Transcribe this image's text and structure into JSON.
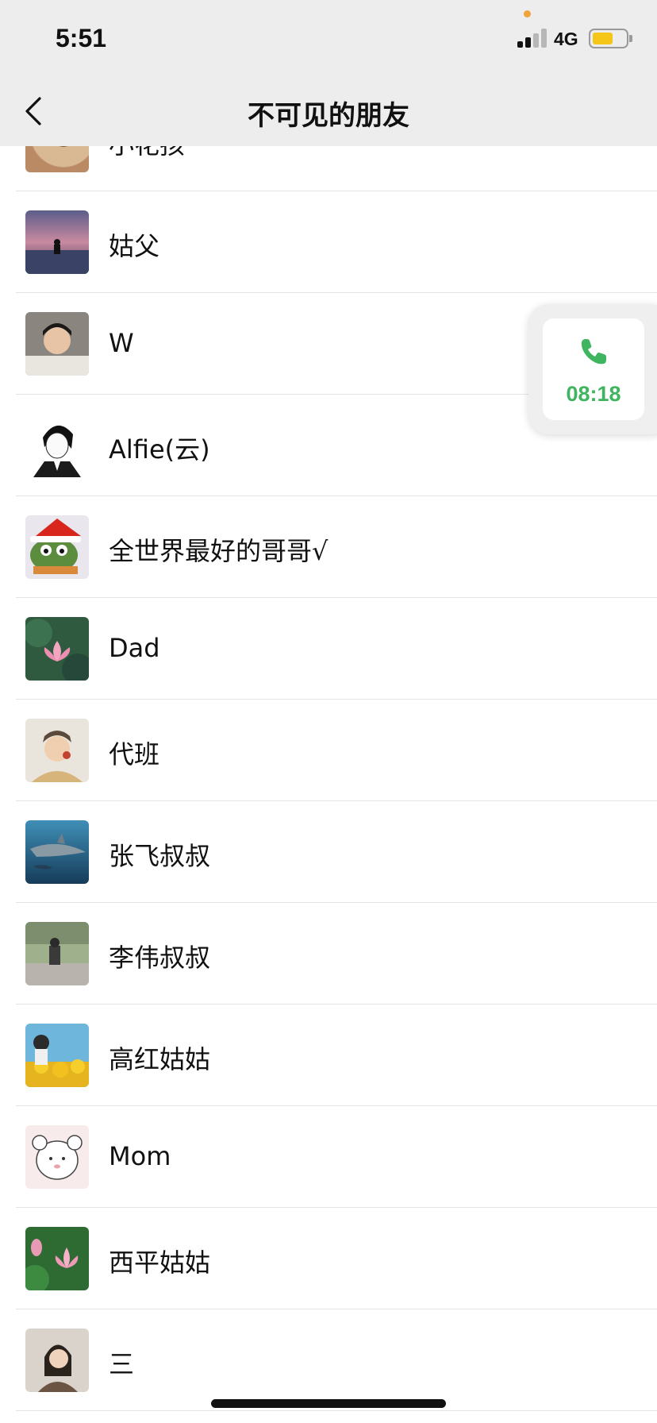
{
  "status_bar": {
    "time": "5:51",
    "network": "4G",
    "battery_level": 0.62,
    "signal_bars": 2
  },
  "nav": {
    "title": "不可见的朋友",
    "back_icon": "chevron-left-icon"
  },
  "call_float": {
    "duration": "08:18",
    "icon": "phone-icon",
    "color": "#3fb55f"
  },
  "contacts": [
    {
      "name": "小花孩"
    },
    {
      "name": "姑父"
    },
    {
      "name": "W"
    },
    {
      "name": "Alfie(云)"
    },
    {
      "name": "全世界最好的哥哥√"
    },
    {
      "name": "Dad"
    },
    {
      "name": "代班"
    },
    {
      "name": "张飞叔叔"
    },
    {
      "name": "李伟叔叔"
    },
    {
      "name": "高红姑姑"
    },
    {
      "name": "Mom"
    },
    {
      "name": "西平姑姑"
    },
    {
      "name": "三"
    }
  ]
}
